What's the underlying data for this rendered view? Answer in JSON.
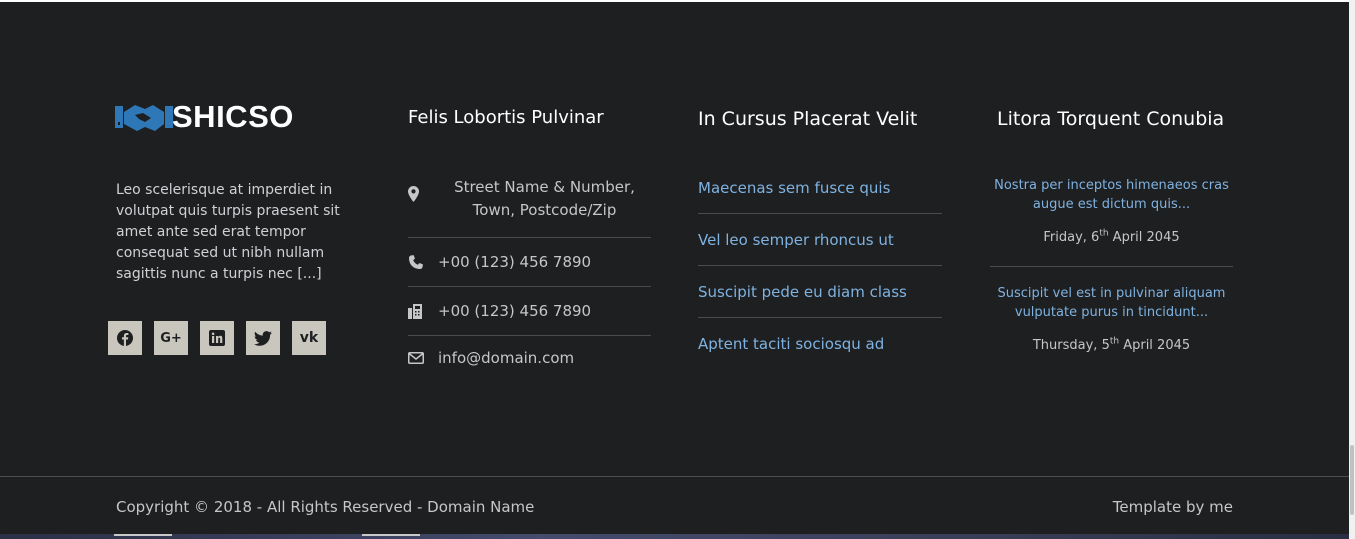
{
  "brand": {
    "name": "SHICSO",
    "logo_icon": "handshake-icon"
  },
  "about": {
    "text": "Leo scelerisque at imperdiet in volutpat quis turpis praesent sit amet ante sed erat tempor consequat sed ut nibh nullam sagittis nunc a turpis nec [...]"
  },
  "socials": [
    {
      "name": "facebook-icon",
      "glyph": "f"
    },
    {
      "name": "google-plus-icon",
      "glyph": "G+"
    },
    {
      "name": "linkedin-icon",
      "glyph": "in"
    },
    {
      "name": "twitter-icon",
      "glyph": "t"
    },
    {
      "name": "vk-icon",
      "glyph": "vk"
    }
  ],
  "contact": {
    "title": "Felis Lobortis Pulvinar",
    "address_line1": "Street Name & Number,",
    "address_line2": "Town, Postcode/Zip",
    "phone": "+00 (123) 456 7890",
    "fax": "+00 (123) 456 7890",
    "email": "info@domain.com"
  },
  "links": {
    "title": "In Cursus Placerat Velit",
    "items": [
      "Maecenas sem fusce quis",
      "Vel leo semper rhoncus ut",
      "Suscipit pede eu diam class",
      "Aptent taciti sociosqu ad"
    ]
  },
  "posts": {
    "title": "Litora Torquent Conubia",
    "items": [
      {
        "title": "Nostra per inceptos himenaeos cras augue est dictum quis...",
        "date_prefix": "Friday, 6",
        "date_sup": "th",
        "date_suffix": " April 2045"
      },
      {
        "title": "Suscipit vel est in pulvinar aliquam vulputate purus in tincidunt...",
        "date_prefix": "Thursday, 5",
        "date_sup": "th",
        "date_suffix": " April 2045"
      }
    ]
  },
  "bottom": {
    "copyright": "Copyright © 2018 - All Rights Reserved - Domain Name",
    "credit": "Template by me"
  },
  "colors": {
    "background": "#1e1f21",
    "link": "#7fb2e0",
    "social_bg": "#c9c7bd",
    "logo_blue": "#2f78b7"
  }
}
